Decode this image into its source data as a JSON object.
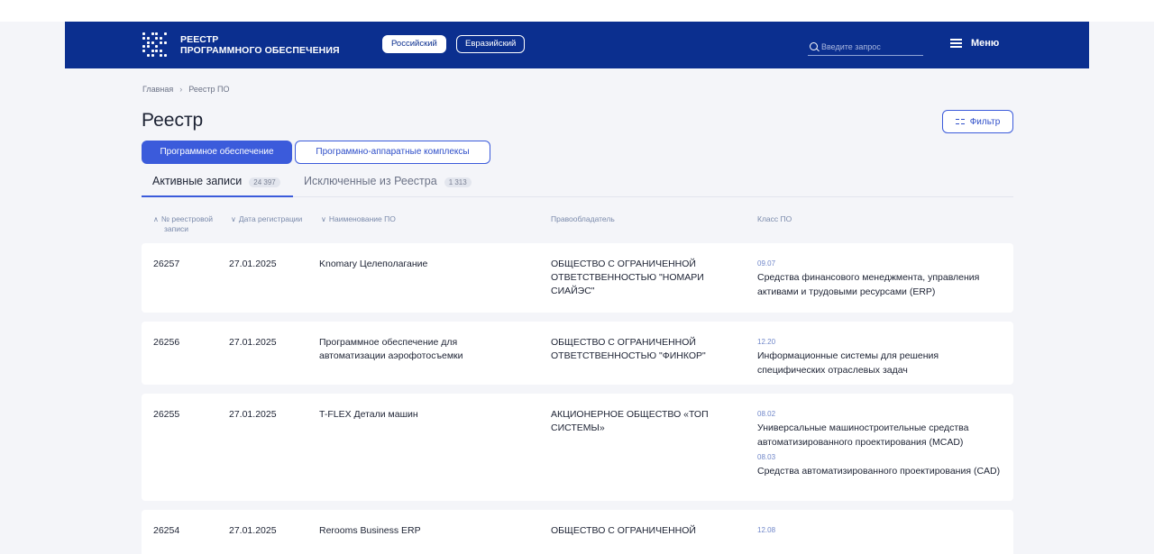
{
  "header": {
    "title_line1": "РЕЕСТР",
    "title_line2": "ПРОГРАММНОГО ОБЕСПЕЧЕНИЯ",
    "toggle_active": "Российский",
    "toggle_inactive": "Евразийский",
    "search_placeholder": "Введите запрос",
    "menu_label": "Меню"
  },
  "breadcrumb": {
    "home": "Главная",
    "current": "Реестр ПО"
  },
  "page_title": "Реестр",
  "filter_label": "Фильтр",
  "segments": {
    "active": "Программное обеспечение",
    "inactive": "Программно-аппаратные комплексы"
  },
  "subtabs": {
    "active_label": "Активные записи",
    "active_count": "24 397",
    "inactive_label": "Исключенные из Реестра",
    "inactive_count": "1 313"
  },
  "columns": {
    "id_line1": "№ реестровой",
    "id_line2": "записи",
    "date": "Дата регистрации",
    "name": "Наименование ПО",
    "owner": "Правообладатель",
    "class": "Класс ПО"
  },
  "rows": [
    {
      "id": "26257",
      "date": "27.01.2025",
      "name": "Knomary Целеполагание",
      "owner": "ОБЩЕСТВО С ОГРАНИЧЕННОЙ ОТВЕТСТВЕННОСТЬЮ \"НОМАРИ СИАЙЭС\"",
      "classes": [
        {
          "code": "09.07",
          "name": "Средства финансового менеджмента, управления активами и трудовыми ресурсами (ERP)"
        }
      ]
    },
    {
      "id": "26256",
      "date": "27.01.2025",
      "name": "Программное обеспечение для автоматизации аэрофотосъемки",
      "owner": "ОБЩЕСТВО С ОГРАНИЧЕННОЙ ОТВЕТСТВЕННОСТЬЮ \"ФИНКОР\"",
      "classes": [
        {
          "code": "12.20",
          "name": "Информационные системы для решения специфических отраслевых задач"
        }
      ]
    },
    {
      "id": "26255",
      "date": "27.01.2025",
      "name": "T-FLEX Детали машин",
      "owner": "АКЦИОНЕРНОЕ ОБЩЕСТВО «ТОП СИСТЕМЫ»",
      "classes": [
        {
          "code": "08.02",
          "name": "Универсальные машиностроительные средства автоматизированного проектирования (MCAD)"
        },
        {
          "code": "08.03",
          "name": "Средства автоматизированного проектирования (CAD)"
        }
      ]
    },
    {
      "id": "26254",
      "date": "27.01.2025",
      "name": "Rerooms Business ERP",
      "owner": "ОБЩЕСТВО С ОГРАНИЧЕННОЙ",
      "classes": [
        {
          "code": "12.08",
          "name": ""
        }
      ]
    }
  ]
}
